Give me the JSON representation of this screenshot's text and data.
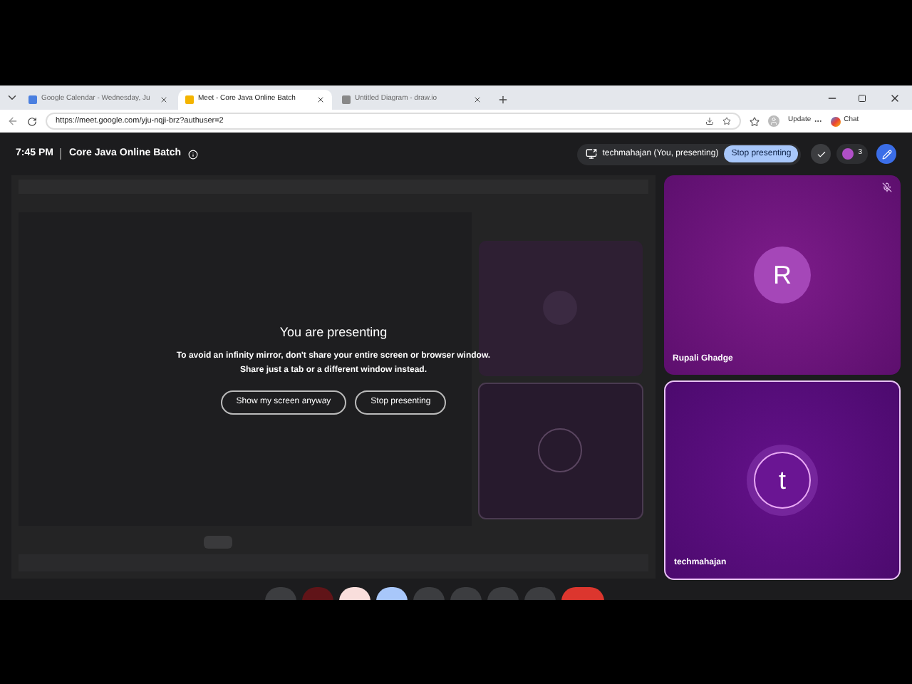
{
  "browser": {
    "tabs": [
      {
        "title": "Google Calendar - Wednesday, Ju",
        "selected": false
      },
      {
        "title": "Meet - Core Java Online Batch",
        "selected": true
      },
      {
        "title": "Untitled Diagram - draw.io",
        "selected": false
      }
    ],
    "url": "https://meet.google.com/yju-nqji-brz?authuser=2",
    "update_label": "Update",
    "chat_label": "Chat"
  },
  "meeting": {
    "time": "7:45 PM",
    "title": "Core Java Online Batch",
    "presenter_label": "techmahajan (You, presenting)",
    "stop_button": "Stop presenting",
    "participant_count": "3"
  },
  "presenting_notice": {
    "heading": "You are presenting",
    "message": "To avoid an infinity mirror, don't share your entire screen or browser window.",
    "message_2": "Share just a tab or a different window instead.",
    "buttons": [
      "Show my screen anyway",
      "Stop presenting"
    ]
  },
  "participants": [
    {
      "name": "Rupali Ghadge",
      "initial": "R",
      "muted": true,
      "active": false
    },
    {
      "name": "techmahajan",
      "initial": "t",
      "muted": false,
      "active": true
    }
  ]
}
